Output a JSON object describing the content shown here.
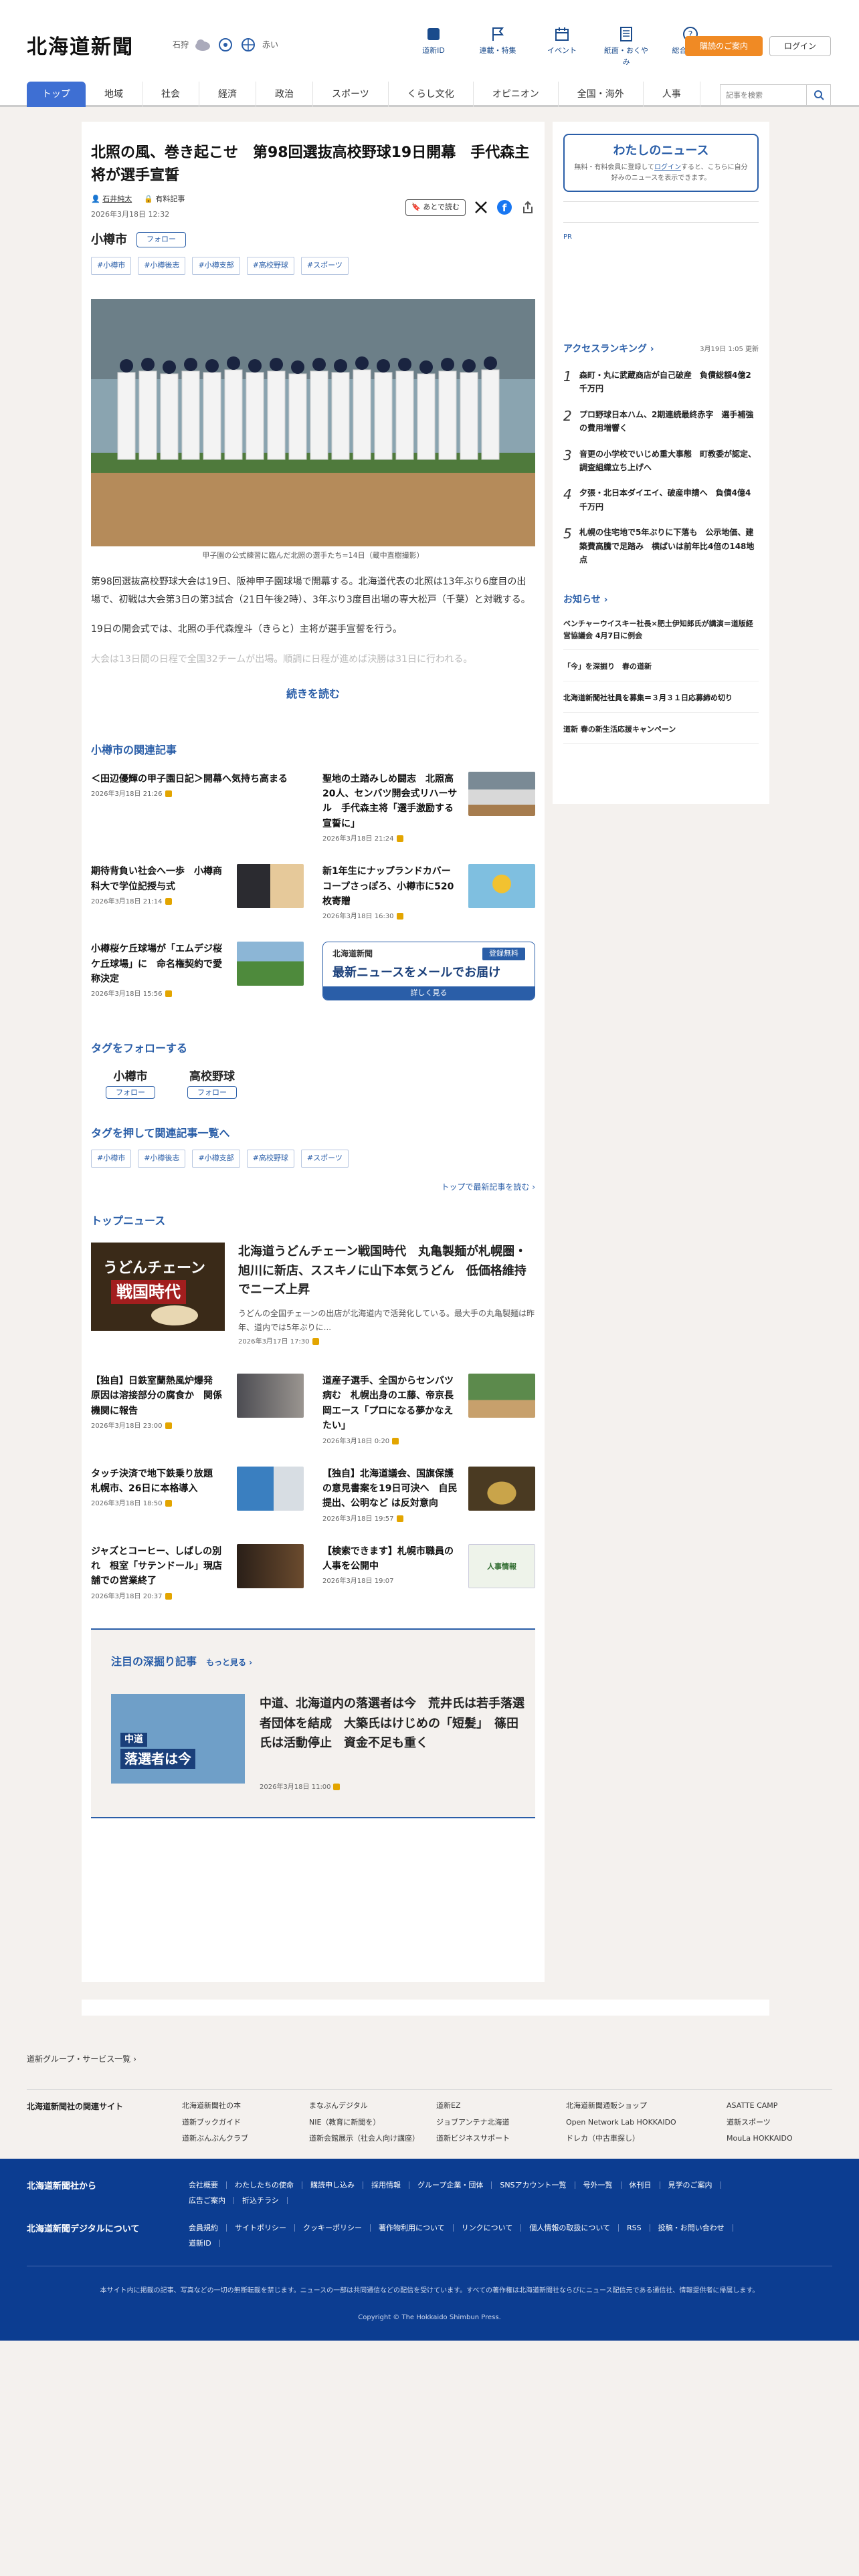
{
  "header": {
    "logo": "北海道新聞",
    "region": "石狩",
    "weather_note": "赤い",
    "nav": [
      {
        "label": "道新ID",
        "icon": "book-icon"
      },
      {
        "label": "連載・特集",
        "icon": "flag-icon"
      },
      {
        "label": "イベント",
        "icon": "calendar-icon"
      },
      {
        "label": "紙面・おくやみ",
        "icon": "newspaper-icon"
      },
      {
        "label": "総合ガイド",
        "icon": "help-icon"
      }
    ],
    "subscribe": "購読のご案内",
    "login": "ログイン"
  },
  "gnav": {
    "tabs": [
      "トップ",
      "地域",
      "社会",
      "経済",
      "政治",
      "スポーツ",
      "くらし文化",
      "オピニオン",
      "全国・海外",
      "人事"
    ],
    "search_placeholder": "記事を検索"
  },
  "article": {
    "title": "北照の風、巻き起こせ　第98回選抜高校野球19日開幕　手代森主将が選手宣誓",
    "author": "石井純太",
    "author_icon": "person-icon",
    "paid_badge": "有料記事",
    "date": "2026年3月18日 12:32",
    "save_label": "あとで読む",
    "city": "小樽市",
    "follow": "フォロー",
    "tags": [
      "#小樽市",
      "#小樽後志",
      "#小樽支部",
      "#高校野球",
      "#スポーツ"
    ],
    "caption": "甲子園の公式練習に臨んだ北照の選手たち=14日（蔵中直樹撮影）",
    "paragraphs": [
      "第98回選抜高校野球大会は19日、阪神甲子園球場で開幕する。北海道代表の北照は13年ぶり6度目の出場で、初戦は大会第3日の第3試合（21日午後2時）、3年ぶり3度目出場の専大松戸（千葉）と対戦する。",
      "19日の開会式では、北照の手代森煌斗（きらと）主将が選手宣誓を行う。",
      "大会は13日間の日程で全国32チームが出場。順調に日程が進めば決勝は31日に行われる。"
    ],
    "read_more": "続きを読む"
  },
  "related": {
    "heading": "小樽市の関連記事",
    "items": [
      {
        "title": "＜田辺優輝の甲子園日記＞開幕へ気持ち高まる",
        "date": "2026年3月18日 21:26",
        "thumb": false
      },
      {
        "title": "聖地の土踏みしめ闘志　北照高20人、センバツ開会式リハーサル　手代森主将「選手激励する宣誓に」",
        "date": "2026年3月18日 21:24",
        "thumb": true
      },
      {
        "title": "期待背負い社会へ一歩　小樽商科大で学位記授与式",
        "date": "2026年3月18日 21:14",
        "thumb": true
      },
      {
        "title": "新1年生にナップランドカバー　コープさっぽろ、小樽市に520枚寄贈",
        "date": "2026年3月18日 16:30",
        "thumb": true
      },
      {
        "title": "小樽桜ケ丘球場が「エムデジ桜ケ丘球場」に　命名権契約で愛称決定",
        "date": "2026年3月18日 15:56",
        "thumb": true
      }
    ],
    "promo": {
      "brand": "北海道新聞",
      "badge": "登録無料",
      "headline": "最新ニュースをメールでお届け",
      "cta": "詳しく見る"
    }
  },
  "follow_tags": {
    "heading": "タグをフォローする",
    "items": [
      {
        "name": "小樽市",
        "btn": "フォロー"
      },
      {
        "name": "高校野球",
        "btn": "フォロー"
      }
    ]
  },
  "tag_related": {
    "heading": "タグを押して関連記事一覧へ",
    "tags": [
      "#小樽市",
      "#小樽後志",
      "#小樽支部",
      "#高校野球",
      "#スポーツ"
    ],
    "latest_link": "トップで最新記事を読む"
  },
  "top_news": {
    "heading": "トップニュース",
    "lead": {
      "img_title_1": "うどんチェーン",
      "img_title_2": "戦国時代",
      "title": "北海道うどんチェーン戦国時代　丸亀製麺が札幌圏・旭川に新店、ススキノに山下本気うどん　低価格維持でニーズ上昇",
      "summary": "うどんの全国チェーンの出店が北海道内で活発化している。最大手の丸亀製麺は昨年、道内では5年ぶりに...",
      "date": "2026年3月17日 17:30"
    },
    "items": [
      {
        "title": "【独自】日鉄室蘭熱風炉爆発　原因は溶接部分の腐食か　関係機関に報告",
        "date": "2026年3月18日 23:00"
      },
      {
        "title": "道産子選手、全国からセンバツ病む　札幌出身のエ藤、帝京長岡エース「プロになる夢かなえたい」",
        "date": "2026年3月18日 0:20"
      },
      {
        "title": "タッチ決済で地下鉄乗り放題　札幌市、26日に本格導入",
        "date": "2026年3月18日 18:50"
      },
      {
        "title": "【独自】北海道議会、国旗保護の意見書案を19日可決へ　自民提出、公明など は反対意向",
        "date": "2026年3月18日 19:57"
      },
      {
        "title": "ジャズとコーヒー、しばしの別れ　根室「サテンドール」現店舗での営業終了",
        "date": "2026年3月18日 20:37"
      },
      {
        "title": "【検索できます】札幌市職員の人事を公開中",
        "date": "2026年3月18日 19:07"
      }
    ],
    "jinji_thumb": "人事情報"
  },
  "deep": {
    "heading": "注目の深掘り記事",
    "more": "もっと見る",
    "img_label_1": "中道",
    "img_label_2": "落選者は今",
    "title": "中道、北海道内の落選者は今　荒井氏は若手落選者団体を結成　大築氏はけじめの「短髪」　篠田氏は活動停止　資金不足も重く",
    "date": "2026年3月18日 11:00"
  },
  "sidebar": {
    "my_news": {
      "heading": "わたしのニュース",
      "text_1": "無料・有料会員に登録して",
      "link": "ログイン",
      "text_2": "すると、こちらに自分好みのニュースを表示できます。"
    },
    "pr": "PR",
    "ranking": {
      "heading": "アクセスランキング",
      "updated": "3月19日 1:05 更新",
      "items": [
        "森町・丸に武蔵商店が自己破産　負債総額4億2千万円",
        "プロ野球日本ハム、2期連続最終赤字　選手補強の費用増響く",
        "音更の小学校でいじめ重大事態　町教委が認定、調査組織立ち上げへ",
        "夕張・北日本ダイエイ、破産申請へ　負債4億4千万円",
        "札幌の住宅地で5年ぶりに下落も　公示地価、建築費高騰で足踏み　横ばいは前年比4倍の148地点"
      ]
    },
    "oshirase": {
      "heading": "お知らせ",
      "items": [
        "ベンチャーウイスキー社長×肥土伊知郎氏が講演＝道版経営協議会 4月7日に例会",
        "「今」を深掘り　春の道新",
        "北海道新聞社社員を募集＝３月３１日応募締め切り",
        "道新 春の新生活応援キャンペーン"
      ]
    }
  },
  "group_link": "道新グループ・サービス一覧",
  "related_sites": {
    "heading": "北海道新聞社の関連サイト",
    "links": [
      "北海道新聞社の本",
      "まなぶんデジタル",
      "道新EZ",
      "北海道新聞通販ショップ",
      "ASATTE CAMP",
      "道新ブックガイド",
      "NIE（教育に新聞を）",
      "ジョブアンテナ北海道",
      "Open Network Lab HOKKAIDO",
      "道新スポーツ",
      "道新ぶんぶんクラブ",
      "道新会館展示（社会人向け講座）",
      "道新ビジネスサポート",
      "ドレカ（中古車探し）",
      "MouLa HOKKAIDO"
    ]
  },
  "footer": {
    "about_heading": "北海道新聞社から",
    "about_links": [
      "会社概要",
      "わたしたちの使命",
      "購読申し込み",
      "採用情報",
      "グループ企業・団体",
      "SNSアカウント一覧",
      "号外一覧",
      "休刊日",
      "見学のご案内",
      "広告ご案内",
      "折込チラシ"
    ],
    "digital_heading": "北海道新聞デジタルについて",
    "digital_links": [
      "会員規約",
      "サイトポリシー",
      "クッキーポリシー",
      "著作物利用について",
      "リンクについて",
      "個人情報の取扱について",
      "RSS",
      "投稿・お問い合わせ",
      "道新ID"
    ],
    "note": "本サイト内に掲載の記事、写真などの一切の無断転載を禁じます。ニュースの一部は共同通信などの配信を受けています。すべての著作権は北海道新聞社ならびにニュース配信元である通信社、情報提供者に帰属します。",
    "copyright": "Copyright © The Hokkaido Shimbun Press."
  },
  "colors": {
    "accent": "#2a5ea8",
    "tab_active": "#3e6fd3",
    "subscribe": "#f08a24",
    "footer": "#0c3d91",
    "paid_badge": "#e3a500"
  }
}
